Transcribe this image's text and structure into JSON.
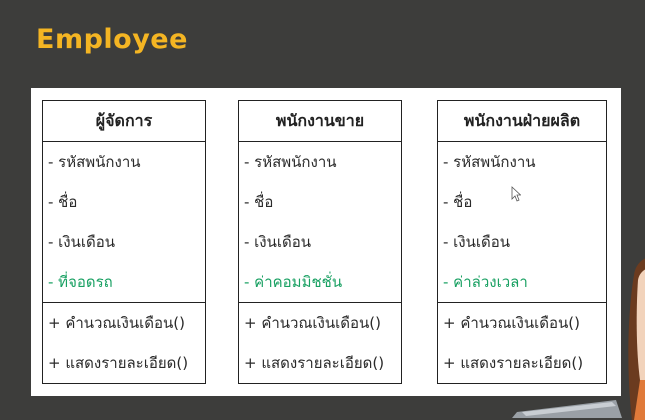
{
  "slide": {
    "title": "Employee"
  },
  "classes": [
    {
      "name": "ผู้จัดการ",
      "attributes": [
        {
          "text": "- รหัสพนักงาน",
          "highlight": false
        },
        {
          "text": "- ชื่อ",
          "highlight": false
        },
        {
          "text": "- เงินเดือน",
          "highlight": false
        },
        {
          "text": "- ที่จอดรถ",
          "highlight": true
        }
      ],
      "methods": [
        "+ คำนวณเงินเดือน()",
        "+ แสดงรายละเอียด()"
      ]
    },
    {
      "name": "พนักงานขาย",
      "attributes": [
        {
          "text": "- รหัสพนักงาน",
          "highlight": false
        },
        {
          "text": "- ชื่อ",
          "highlight": false
        },
        {
          "text": "- เงินเดือน",
          "highlight": false
        },
        {
          "text": "- ค่าคอมมิชชั่น",
          "highlight": true
        }
      ],
      "methods": [
        "+ คำนวณเงินเดือน()",
        "+ แสดงรายละเอียด()"
      ]
    },
    {
      "name": "พนักงานฝ่ายผลิต",
      "attributes": [
        {
          "text": "- รหัสพนักงาน",
          "highlight": false
        },
        {
          "text": "- ชื่อ",
          "highlight": false
        },
        {
          "text": "- เงินเดือน",
          "highlight": false
        },
        {
          "text": "- ค่าล่วงเวลา",
          "highlight": true
        }
      ],
      "methods": [
        "+ คำนวณเงินเดือน()",
        "+ แสดงรายละเอียด()"
      ]
    }
  ],
  "colors": {
    "background": "#3d3d3b",
    "title": "#f4b523",
    "highlight_attribute": "#18a062",
    "border": "#222222"
  },
  "icons": {
    "cursor": "mouse-pointer-icon"
  }
}
